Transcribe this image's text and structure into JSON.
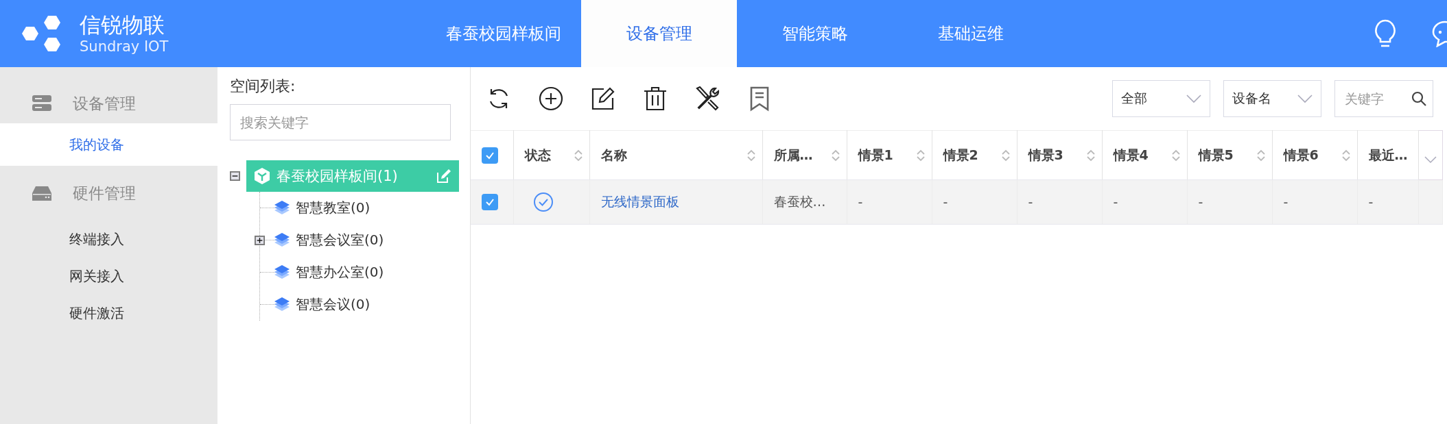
{
  "header": {
    "logo": {
      "title": "信锐物联",
      "subtitle": "Sundray IOT"
    },
    "nav": [
      {
        "label": "春蚕校园样板间",
        "selected": false
      },
      {
        "label": "设备管理",
        "selected": true
      },
      {
        "label": "智能策略",
        "selected": false
      },
      {
        "label": "基础运维",
        "selected": false
      }
    ]
  },
  "sidebar": {
    "groups": [
      {
        "label": "设备管理",
        "items": [
          {
            "label": "我的设备",
            "selected": true
          }
        ]
      },
      {
        "label": "硬件管理",
        "items": [
          {
            "label": "终端接入",
            "selected": false
          },
          {
            "label": "网关接入",
            "selected": false
          },
          {
            "label": "硬件激活",
            "selected": false
          }
        ]
      }
    ]
  },
  "space_tree": {
    "title": "空间列表:",
    "search": {
      "placeholder": "搜索关键字"
    },
    "root": {
      "label": "春蚕校园样板间(1)",
      "selected": true,
      "expanded": true,
      "children": [
        {
          "label": "智慧教室(0)",
          "collapsed": false
        },
        {
          "label": "智慧会议室(0)",
          "collapsed": true
        },
        {
          "label": "智慧办公室(0)",
          "collapsed": false
        },
        {
          "label": "智慧会议(0)",
          "collapsed": false
        }
      ]
    }
  },
  "filters": [
    {
      "kind": "select",
      "value": "全部"
    },
    {
      "kind": "select",
      "value": "设备名"
    },
    {
      "kind": "search",
      "placeholder": "关键字"
    }
  ],
  "table": {
    "select_all": {
      "checked": true
    },
    "columns": [
      {
        "label": "状态",
        "sortable": true
      },
      {
        "label": "名称",
        "sortable": true
      },
      {
        "label": "所属…",
        "sortable": true
      },
      {
        "label": "情景1",
        "sortable": true
      },
      {
        "label": "情景2",
        "sortable": true
      },
      {
        "label": "情景3",
        "sortable": true
      },
      {
        "label": "情景4",
        "sortable": true
      },
      {
        "label": "情景5",
        "sortable": true
      },
      {
        "label": "情景6",
        "sortable": true
      },
      {
        "label": "最近…",
        "sortable": false
      }
    ],
    "rows": [
      {
        "checked": true,
        "online": true,
        "cells": [
          "",
          "无线情景面板",
          "春蚕校…",
          "-",
          "-",
          "-",
          "-",
          "-",
          "-",
          "-"
        ]
      }
    ]
  }
}
